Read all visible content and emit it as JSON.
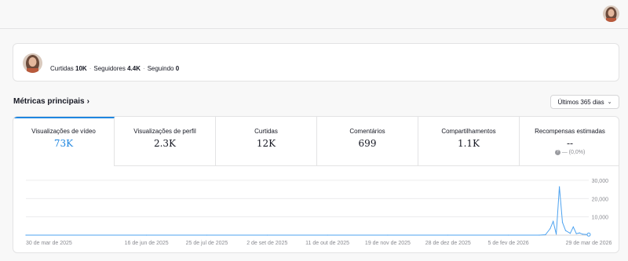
{
  "profile": {
    "stats": [
      {
        "label": "Curtidas",
        "value": "10K"
      },
      {
        "label": "Seguidores",
        "value": "4.4K"
      },
      {
        "label": "Seguindo",
        "value": "0"
      }
    ]
  },
  "section": {
    "title": "Métricas principais"
  },
  "range": {
    "label": "Últimos 365 dias"
  },
  "tabs": [
    {
      "label": "Visualizações de vídeo",
      "value": "73K"
    },
    {
      "label": "Visualizações de perfil",
      "value": "2.3K"
    },
    {
      "label": "Curtidas",
      "value": "12K"
    },
    {
      "label": "Comentários",
      "value": "699"
    },
    {
      "label": "Compartilhamentos",
      "value": "1.1K"
    },
    {
      "label": "Recompensas estimadas",
      "value": "--",
      "change": "— (0,0%)"
    }
  ],
  "colors": {
    "accent": "#1f86e0",
    "line": "#4ea3f0"
  },
  "chart_data": {
    "type": "line",
    "x_ticks": [
      "30 de mar de 2025",
      "16 de jun de 2025",
      "25 de jul de 2025",
      "2 de set de 2025",
      "11 de out de 2025",
      "19 de nov de 2025",
      "28 de dez de 2025",
      "5 de fev de 2026",
      "29 de mar de 2026"
    ],
    "y_ticks": [
      "30,000",
      "20,000",
      "10,000"
    ],
    "ylim": [
      0,
      30000
    ],
    "series": [
      {
        "x": [
          "2025-03-30",
          "2025-06-16",
          "2025-07-25",
          "2025-09-02",
          "2025-10-11",
          "2025-11-19",
          "2025-12-28",
          "2026-02-05",
          "2026-02-25",
          "2026-03-01",
          "2026-03-04",
          "2026-03-06",
          "2026-03-08",
          "2026-03-10",
          "2026-03-12",
          "2026-03-14",
          "2026-03-17",
          "2026-03-19",
          "2026-03-21",
          "2026-03-23",
          "2026-03-25",
          "2026-03-27",
          "2026-03-29"
        ],
        "values": [
          0,
          0,
          0,
          0,
          0,
          0,
          0,
          0,
          0,
          200,
          3500,
          7500,
          500,
          26500,
          7000,
          2500,
          1000,
          4500,
          800,
          1200,
          500,
          400,
          300
        ]
      }
    ],
    "grid": true
  }
}
